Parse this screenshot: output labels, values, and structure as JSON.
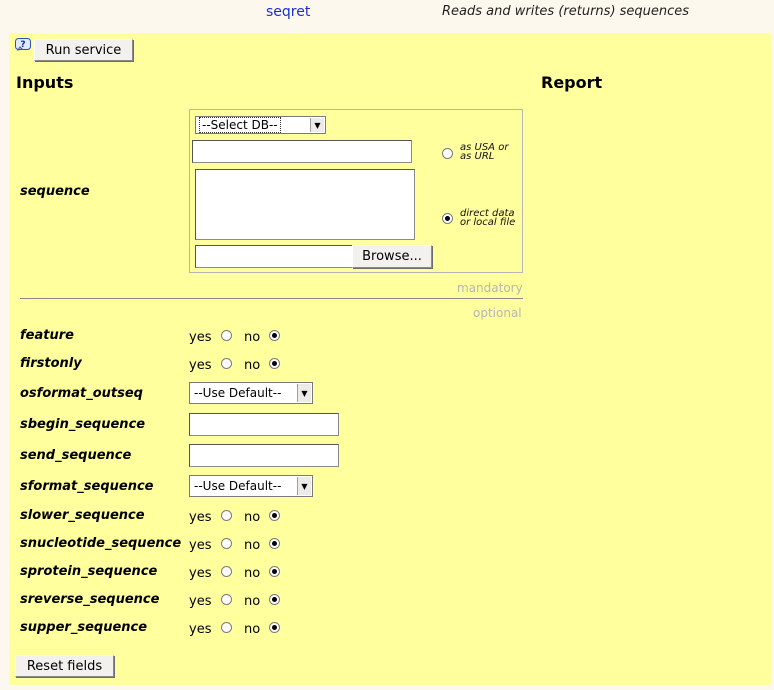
{
  "header": {
    "tool_name": "seqret",
    "tool_description": "Reads and writes (returns) sequences"
  },
  "toolbar": {
    "help_icon": "help-icon",
    "run_label": "Run service"
  },
  "sections": {
    "inputs": "Inputs",
    "report": "Report"
  },
  "sequence": {
    "label": "sequence",
    "db_select_value": "--Select DB--",
    "usa_input_value": "",
    "usa_option_label_line1": "as USA or",
    "usa_option_label_line2": "as URL",
    "direct_textarea_value": "",
    "direct_option_label_line1": "direct data",
    "direct_option_label_line2": "or local file",
    "selected_option": "direct",
    "file_input_value": "",
    "browse_label": "Browse...",
    "mandatory_label": "mandatory"
  },
  "optional_label": "optional",
  "yes_label": "yes",
  "no_label": "no",
  "params": {
    "feature": {
      "label": "feature",
      "value": "no"
    },
    "firstonly": {
      "label": "firstonly",
      "value": "no"
    },
    "osformat_outseq": {
      "label": "osformat_outseq",
      "value": "--Use Default--"
    },
    "sbegin_sequence": {
      "label": "sbegin_sequence",
      "value": ""
    },
    "send_sequence": {
      "label": "send_sequence",
      "value": ""
    },
    "sformat_sequence": {
      "label": "sformat_sequence",
      "value": "--Use Default--"
    },
    "slower_sequence": {
      "label": "slower_sequence",
      "value": "no"
    },
    "snucleotide_sequence": {
      "label": "snucleotide_sequence",
      "value": "no"
    },
    "sprotein_sequence": {
      "label": "sprotein_sequence",
      "value": "no"
    },
    "sreverse_sequence": {
      "label": "sreverse_sequence",
      "value": "no"
    },
    "supper_sequence": {
      "label": "supper_sequence",
      "value": "no"
    }
  },
  "footer": {
    "reset_label": "Reset fields"
  }
}
